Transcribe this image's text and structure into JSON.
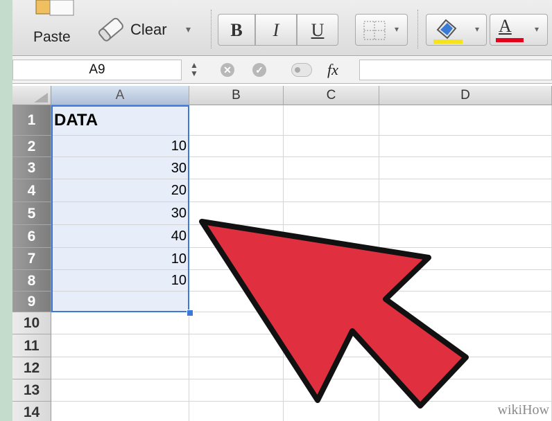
{
  "toolbar": {
    "paste_label": "Paste",
    "clear_label": "Clear",
    "clear_dropdown": "▾",
    "bold_label": "B",
    "italic_label": "I",
    "underline_label": "U",
    "font_color_label": "A",
    "fill_color": "#f5e31d",
    "font_color": "#e3001b"
  },
  "formula_bar": {
    "name_box": "A9",
    "fx_label": "fx",
    "cancel_glyph": "✕",
    "confirm_glyph": "✓"
  },
  "sheet": {
    "columns": [
      "A",
      "B",
      "C",
      "D"
    ],
    "rows": [
      "1",
      "2",
      "3",
      "4",
      "5",
      "6",
      "7",
      "8",
      "9",
      "10",
      "11",
      "12",
      "13",
      "14"
    ],
    "values": {
      "a1": "DATA",
      "a2": "10",
      "a3": "30",
      "a4": "20",
      "a5": "30",
      "a6": "40",
      "a7": "10",
      "a8": "10"
    },
    "selection_color": "#3c78d8"
  },
  "annotation": {
    "arrow_color": "#e03040"
  },
  "watermark": "wikiHow"
}
